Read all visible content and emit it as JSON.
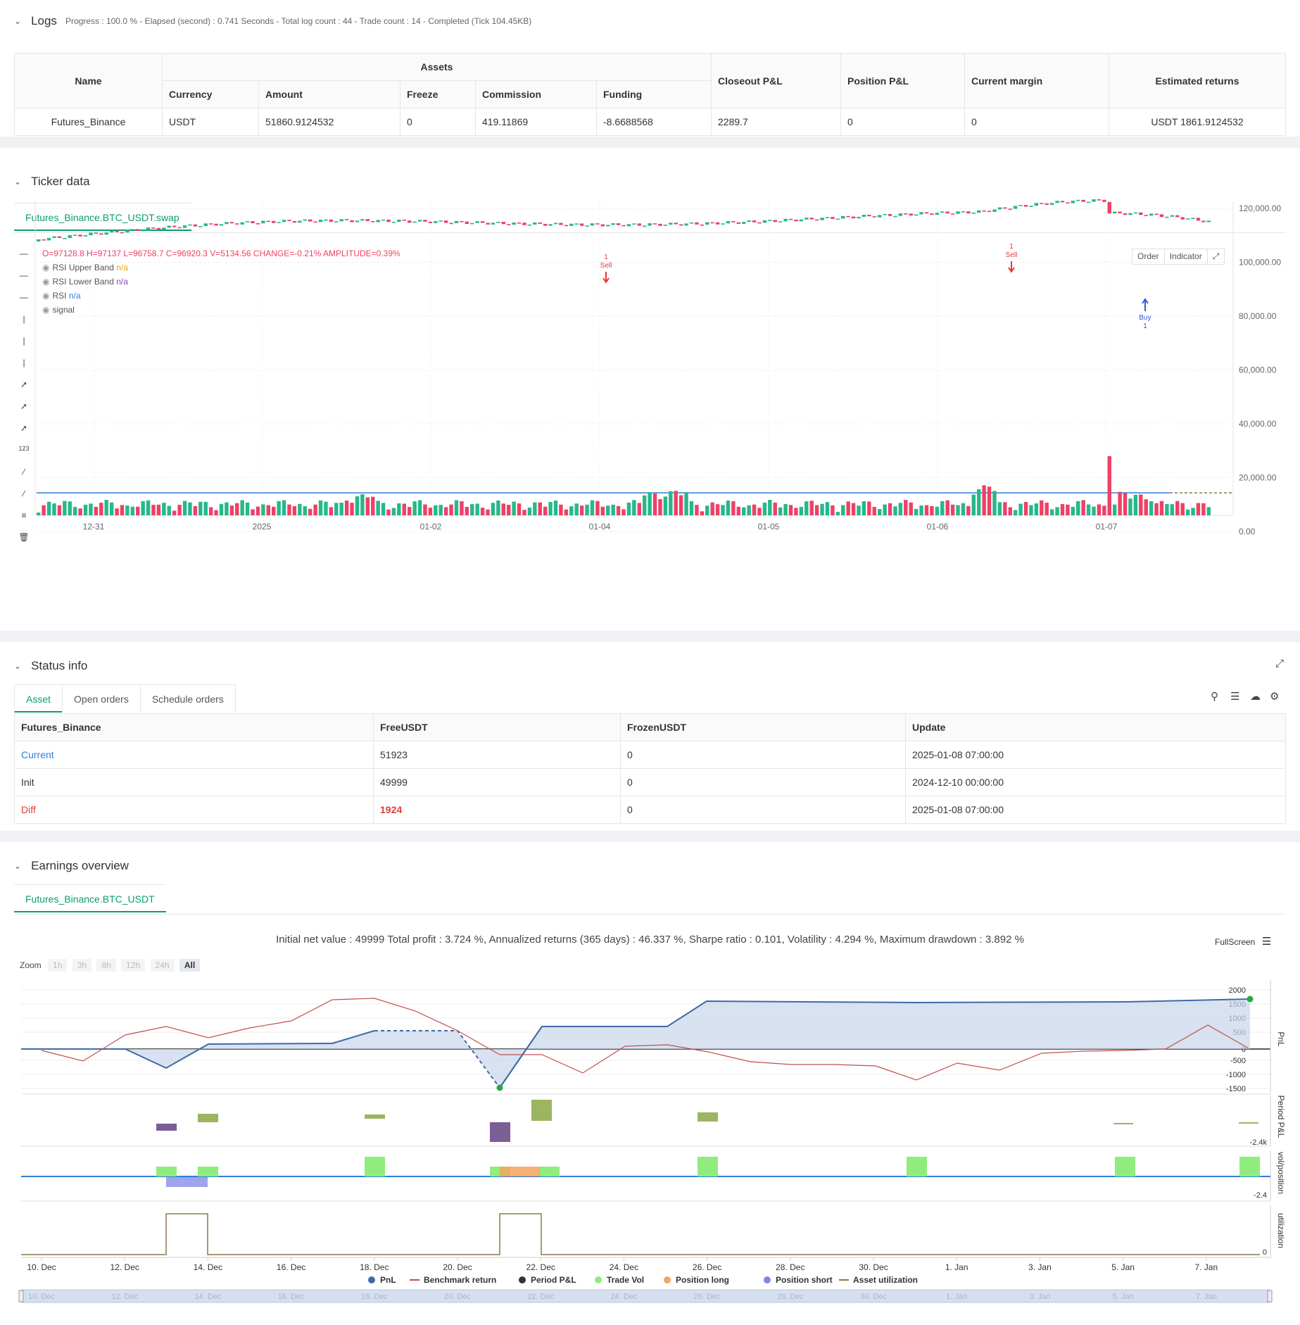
{
  "logs": {
    "title": "Logs",
    "status": "Progress : 100.0 % - Elapsed (second) : 0.741  Seconds - Total log count : 44 - Trade count : 14 - Completed (Tick 104.45KB)",
    "headers": {
      "name": "Name",
      "assets": "Assets",
      "currency": "Currency",
      "amount": "Amount",
      "freeze": "Freeze",
      "commission": "Commission",
      "funding": "Funding",
      "closeout": "Closeout P&L",
      "position": "Position P&L",
      "margin": "Current margin",
      "returns": "Estimated returns"
    },
    "row": {
      "name": "Futures_Binance",
      "currency": "USDT",
      "amount": "51860.9124532",
      "freeze": "0",
      "commission": "419.11869",
      "funding": "-8.6688568",
      "closeout": "2289.7",
      "position": "0",
      "margin": "0",
      "returns": "USDT 1861.9124532"
    }
  },
  "ticker": {
    "title": "Ticker data",
    "tab": "Futures_Binance.BTC_USDT.swap",
    "ohlc": "O=97128.8 H=97137 L=96758.7 C=96920.3 V=5134.56 CHANGE=-0.21% AMPLITUDE=0.39%",
    "legend": [
      {
        "label": "RSI Upper Band",
        "value": "n/a",
        "color": "#f2a100"
      },
      {
        "label": "RSI Lower Band",
        "value": "n/a",
        "color": "#8e44ad"
      },
      {
        "label": "RSI",
        "value": "n/a",
        "color": "#2d7fd8"
      },
      {
        "label": "signal",
        "value": "",
        "color": "#555"
      }
    ],
    "buttons": {
      "order": "Order",
      "indicator": "Indicator"
    },
    "y_ticks": [
      "120,000.00",
      "100,000.00",
      "80,000.00",
      "60,000.00",
      "40,000.00",
      "20,000.00",
      "0.00"
    ],
    "x_ticks": [
      "12-31",
      "2025",
      "01-02",
      "01-04",
      "01-05",
      "01-06",
      "01-07"
    ],
    "markers": [
      {
        "type": "Sell",
        "count": "1"
      },
      {
        "type": "Sell",
        "count": "1"
      },
      {
        "type": "Buy",
        "count": "1"
      }
    ],
    "colors": {
      "up": "#26b88a",
      "down": "#ef4066"
    }
  },
  "status": {
    "title": "Status info",
    "tabs": [
      "Asset",
      "Open orders",
      "Schedule orders"
    ],
    "headers": [
      "Futures_Binance",
      "FreeUSDT",
      "FrozenUSDT",
      "Update"
    ],
    "rows": [
      {
        "label": "Current",
        "free": "51923",
        "frozen": "0",
        "update": "2025-01-08 07:00:00"
      },
      {
        "label": "Init",
        "free": "49999",
        "frozen": "0",
        "update": "2024-12-10 00:00:00"
      },
      {
        "label": "Diff",
        "free": "1924",
        "frozen": "0",
        "update": "2025-01-08 07:00:00"
      }
    ]
  },
  "earnings": {
    "title": "Earnings overview",
    "tab": "Futures_Binance.BTC_USDT",
    "summary": "Initial net value : 49999  Total profit : 3.724 %, Annualized returns (365 days) : 46.337 %, Sharpe ratio : 0.101, Volatility : 4.294 %, Maximum drawdown : 3.892 %",
    "fullscreen": "FullScreen",
    "zoom_label": "Zoom",
    "zoom": [
      "1h",
      "3h",
      "8h",
      "12h",
      "24h",
      "All"
    ],
    "pnl_ticks": [
      "2000",
      "1500",
      "1000",
      "500",
      "0",
      "-500",
      "-1000",
      "-1500"
    ],
    "axis_titles": [
      "PnL",
      "Period P&L",
      "vol/position",
      "utilization"
    ],
    "period_min": "-2.4k",
    "vol_min": "-2.4",
    "util_zero": "0",
    "x_ticks": [
      "10. Dec",
      "12. Dec",
      "14. Dec",
      "16. Dec",
      "18. Dec",
      "20. Dec",
      "22. Dec",
      "24. Dec",
      "26. Dec",
      "28. Dec",
      "30. Dec",
      "1. Jan",
      "3. Jan",
      "5. Jan",
      "7. Jan"
    ],
    "legend": [
      {
        "label": "PnL",
        "color": "#3d6aa8"
      },
      {
        "label": "Benchmark return",
        "color": "#c0504d"
      },
      {
        "label": "Period P&L",
        "color": "#333333"
      },
      {
        "label": "Trade Vol",
        "color": "#90ed7d"
      },
      {
        "label": "Position long",
        "color": "#f7a35c"
      },
      {
        "label": "Position short",
        "color": "#8085e9"
      },
      {
        "label": "Asset utilization",
        "color": "#8c7a48"
      }
    ]
  }
}
